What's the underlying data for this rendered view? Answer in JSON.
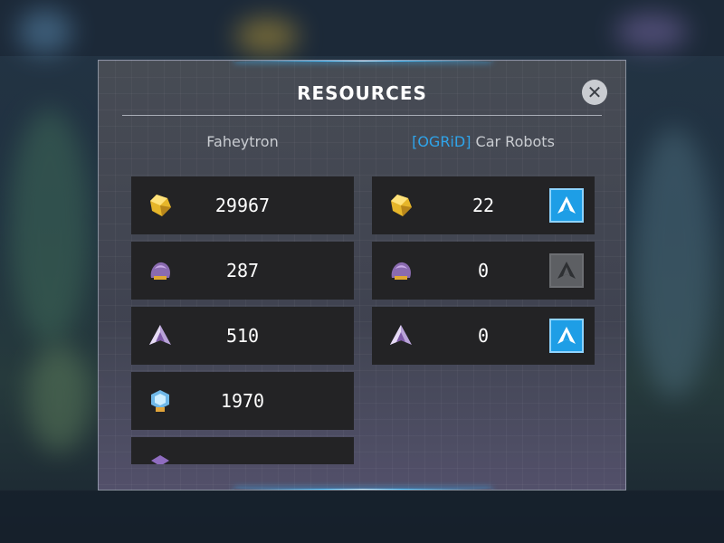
{
  "dialog": {
    "title": "RESOURCES",
    "close_icon": "close-icon"
  },
  "left": {
    "header": "Faheytron",
    "resources": [
      {
        "icon": "gold-crystal-icon",
        "value": "29967"
      },
      {
        "icon": "purple-ore-icon",
        "value": "287"
      },
      {
        "icon": "energon-shard-icon",
        "value": "510"
      },
      {
        "icon": "blue-core-icon",
        "value": "1970"
      },
      {
        "icon": "violet-gem-icon",
        "value": ""
      }
    ]
  },
  "right": {
    "header_tag": "[OGRiD]",
    "header_name": " Car Robots",
    "resources": [
      {
        "icon": "gold-crystal-icon",
        "value": "22",
        "send": "active"
      },
      {
        "icon": "purple-ore-icon",
        "value": "0",
        "send": "disabled"
      },
      {
        "icon": "energon-shard-icon",
        "value": "0",
        "send": "active"
      }
    ]
  },
  "colors": {
    "accent": "#1e9ee6",
    "tag": "#2fa4ea",
    "row_bg": "#232325"
  }
}
